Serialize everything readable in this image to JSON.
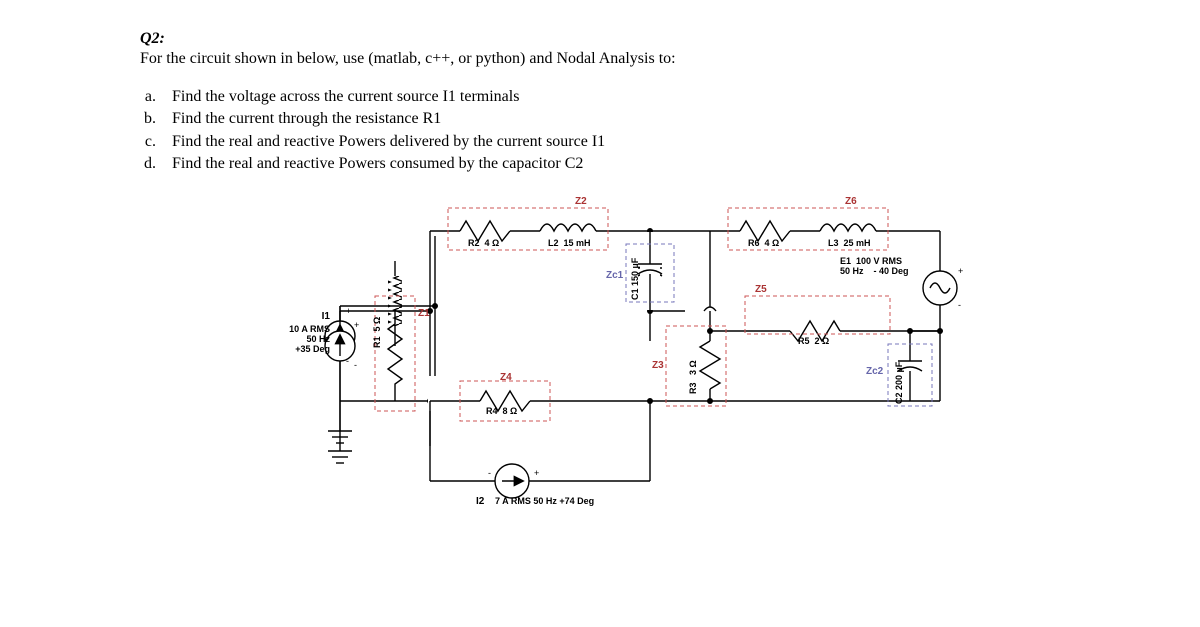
{
  "header": {
    "title": "Q2:",
    "intro": "For the circuit shown in below,  use (matlab, c++, or python)  and Nodal Analysis  to:"
  },
  "tasks": [
    "Find the voltage across the current source I1 terminals",
    "Find the current through the resistance R1",
    "Find the real and reactive Powers delivered by the current source I1",
    "Find the real and reactive Powers consumed  by the capacitor C2"
  ],
  "circuit": {
    "I1": {
      "name": "I1",
      "spec": "10 A RMS\n50 Hz\n+35 Deg"
    },
    "I2": {
      "name": "I2",
      "spec": "7 A RMS  50 Hz  +74 Deg"
    },
    "E1": {
      "name": "E1",
      "spec": "100 V RMS\n50 Hz    - 40 Deg"
    },
    "R1": {
      "name": "R1",
      "val": "5 Ω"
    },
    "R2": {
      "name": "R2",
      "val": "4 Ω"
    },
    "R3": {
      "name": "R3",
      "val": "3 Ω"
    },
    "R4": {
      "name": "R4",
      "val": "8 Ω"
    },
    "R5": {
      "name": "R5",
      "val": "2 Ω"
    },
    "R6": {
      "name": "R6",
      "val": "4 Ω"
    },
    "L2": {
      "name": "L2",
      "val": "15 mH"
    },
    "L3": {
      "name": "L3",
      "val": "25 mH"
    },
    "C1": {
      "name": "C1",
      "val": "150 µF"
    },
    "C2": {
      "name": "C2",
      "val": "200 µF"
    },
    "Z1": "Z1",
    "Z2": "Z2",
    "Z3": "Z3",
    "Z4": "Z4",
    "Z5": "Z5",
    "Z6": "Z6",
    "Zc1": "Zc1",
    "Zc2": "Zc2"
  }
}
